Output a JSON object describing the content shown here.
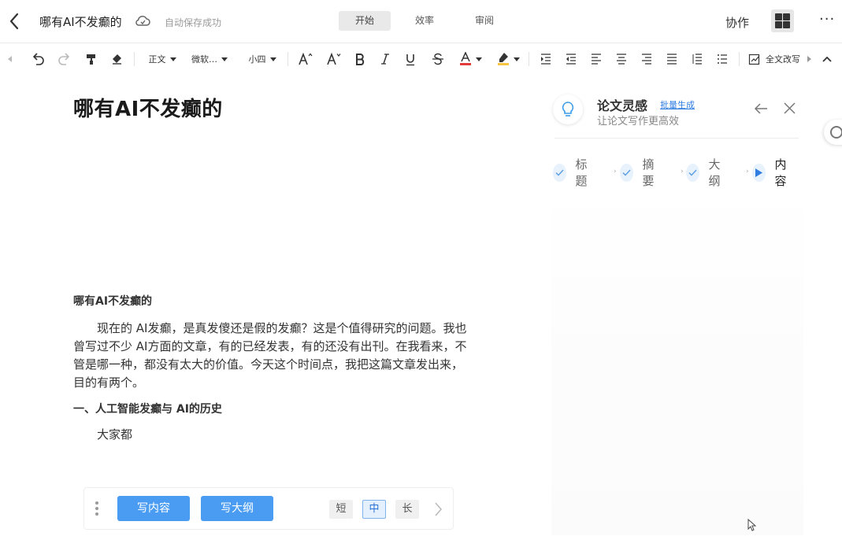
{
  "header": {
    "doc_title": "哪有AI不发癫的",
    "save_status": "自动保存成功",
    "tabs": [
      {
        "label": "开始",
        "active": true
      },
      {
        "label": "效率",
        "active": false
      },
      {
        "label": "审阅",
        "active": false
      }
    ],
    "collab_label": "协作",
    "more_label": "···"
  },
  "toolbar": {
    "style_label": "正文",
    "font_label": "微软…",
    "size_label": "小四",
    "full_edit_label": "全文改写",
    "font_color": "#e23b3b",
    "highlight_color": "#f5c542",
    "icons": [
      "undo-icon",
      "redo-icon",
      "format-painter-icon",
      "eraser-icon",
      "font-grow-icon",
      "font-shrink-icon",
      "bold-icon",
      "italic-icon",
      "underline-icon",
      "strikethrough-icon",
      "font-color-icon",
      "highlight-icon",
      "indent-increase-icon",
      "indent-decrease-icon",
      "align-left-icon",
      "align-center-icon",
      "align-right-icon",
      "justify-icon",
      "line-spacing-icon",
      "numbered-list-icon",
      "collapse-icon"
    ]
  },
  "document": {
    "title": "哪有AI不发癫的",
    "section_title": "哪有AI不发癫的",
    "paragraph1": "现在的 AI发癫，是真发傻还是假的发癫？这是个值得研究的问题。我也曾写过不少 AI方面的文章，有的已经发表，有的还没有出刊。在我看来，不管是哪一种，都没有太大的价值。今天这个时间点，我把这篇文章发出来，目的有两个。",
    "heading1": "一、人工智能发癫与 AI的历史",
    "paragraph2": "大家都"
  },
  "writebar": {
    "write_content_label": "写内容",
    "write_outline_label": "写大纲",
    "lengths": [
      {
        "label": "短",
        "active": false
      },
      {
        "label": "中",
        "active": true
      },
      {
        "label": "长",
        "active": false
      }
    ]
  },
  "panel": {
    "title": "论文灵感",
    "batch_link": "批量生成",
    "subtitle": "让论文写作更高效",
    "steps": [
      {
        "label": "标题",
        "state": "done"
      },
      {
        "label": "摘要",
        "state": "done"
      },
      {
        "label": "大纲",
        "state": "done"
      },
      {
        "label": "内容",
        "state": "current"
      }
    ]
  },
  "colors": {
    "accent": "#4a9cf3",
    "link": "#2f7de1",
    "step_bg": "#e8f2fd"
  }
}
